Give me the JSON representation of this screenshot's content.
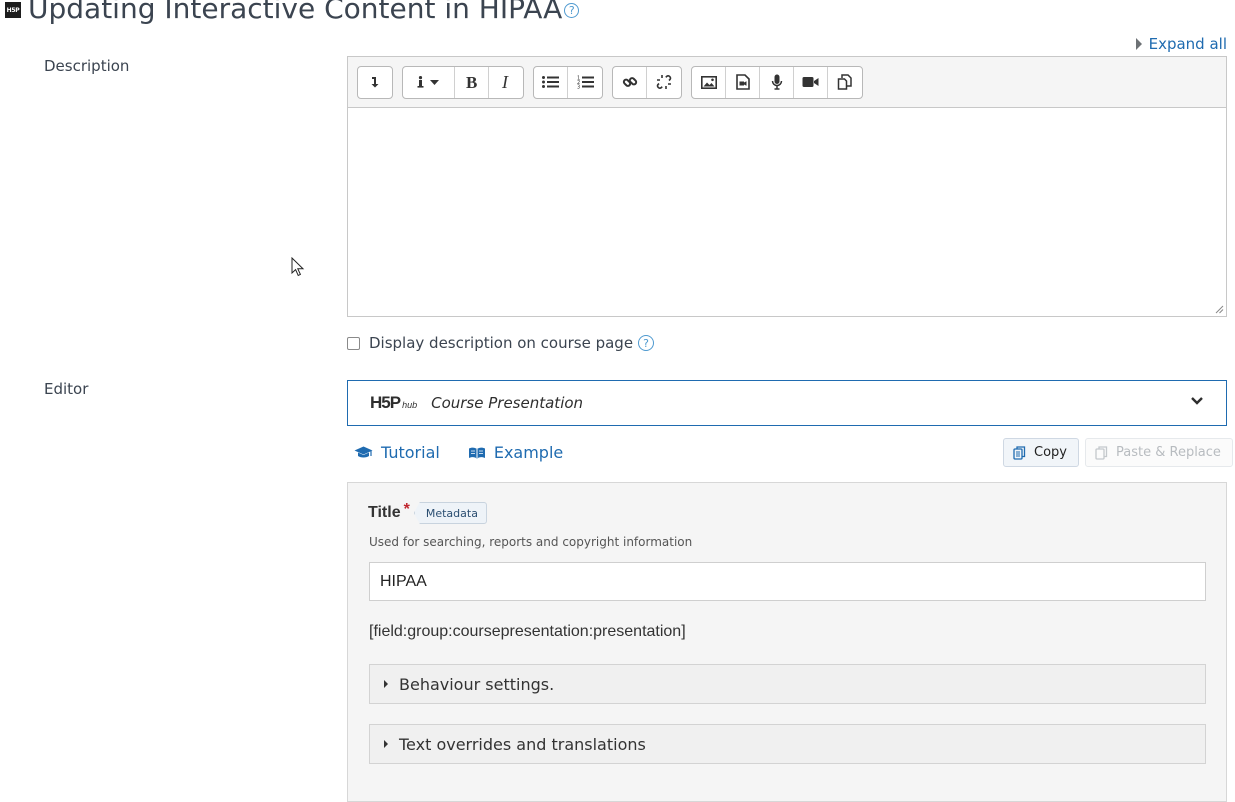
{
  "heading": {
    "module_icon_text": "H5P",
    "title": "Updating Interactive Content in HIPAA",
    "help_glyph": "?"
  },
  "expand_all_label": "Expand all",
  "description_section": {
    "label": "Description",
    "toolbar": [
      {
        "name": "collapse-toolbar-button",
        "icon": "collapse-arrow-icon"
      },
      {
        "name": "paragraph-styles-button",
        "icon": "info-dropdown-icon"
      },
      {
        "name": "bold-button",
        "icon": "bold-icon"
      },
      {
        "name": "italic-button",
        "icon": "italic-icon"
      },
      {
        "name": "unordered-list-button",
        "icon": "bullet-list-icon"
      },
      {
        "name": "ordered-list-button",
        "icon": "numbered-list-icon"
      },
      {
        "name": "link-button",
        "icon": "link-icon"
      },
      {
        "name": "unlink-button",
        "icon": "unlink-icon"
      },
      {
        "name": "insert-image-button",
        "icon": "image-icon"
      },
      {
        "name": "insert-media-button",
        "icon": "media-file-icon"
      },
      {
        "name": "record-audio-button",
        "icon": "microphone-icon"
      },
      {
        "name": "record-video-button",
        "icon": "video-camera-icon"
      },
      {
        "name": "manage-files-button",
        "icon": "files-icon"
      }
    ],
    "content": ""
  },
  "display_description": {
    "label": "Display description on course page",
    "checked": false,
    "help_glyph": "?"
  },
  "editor_section": {
    "label": "Editor",
    "hub": {
      "logo_text": "H5P",
      "logo_sub": "hub",
      "content_type": "Course Presentation"
    },
    "links": {
      "tutorial": "Tutorial",
      "example": "Example"
    },
    "copy_label": "Copy",
    "paste_replace_label": "Paste & Replace",
    "form": {
      "title_label": "Title",
      "required_mark": "*",
      "metadata_label": "Metadata",
      "title_description": "Used for searching, reports and copyright information",
      "title_value": "HIPAA",
      "field_token": "[field:group:coursepresentation:presentation]",
      "behaviour_label": "Behaviour settings.",
      "text_overrides_label": "Text overrides and translations"
    }
  },
  "colors": {
    "link_blue": "#1f6bb0",
    "required_red": "#c0262e",
    "panel_bg": "#f5f5f5"
  }
}
